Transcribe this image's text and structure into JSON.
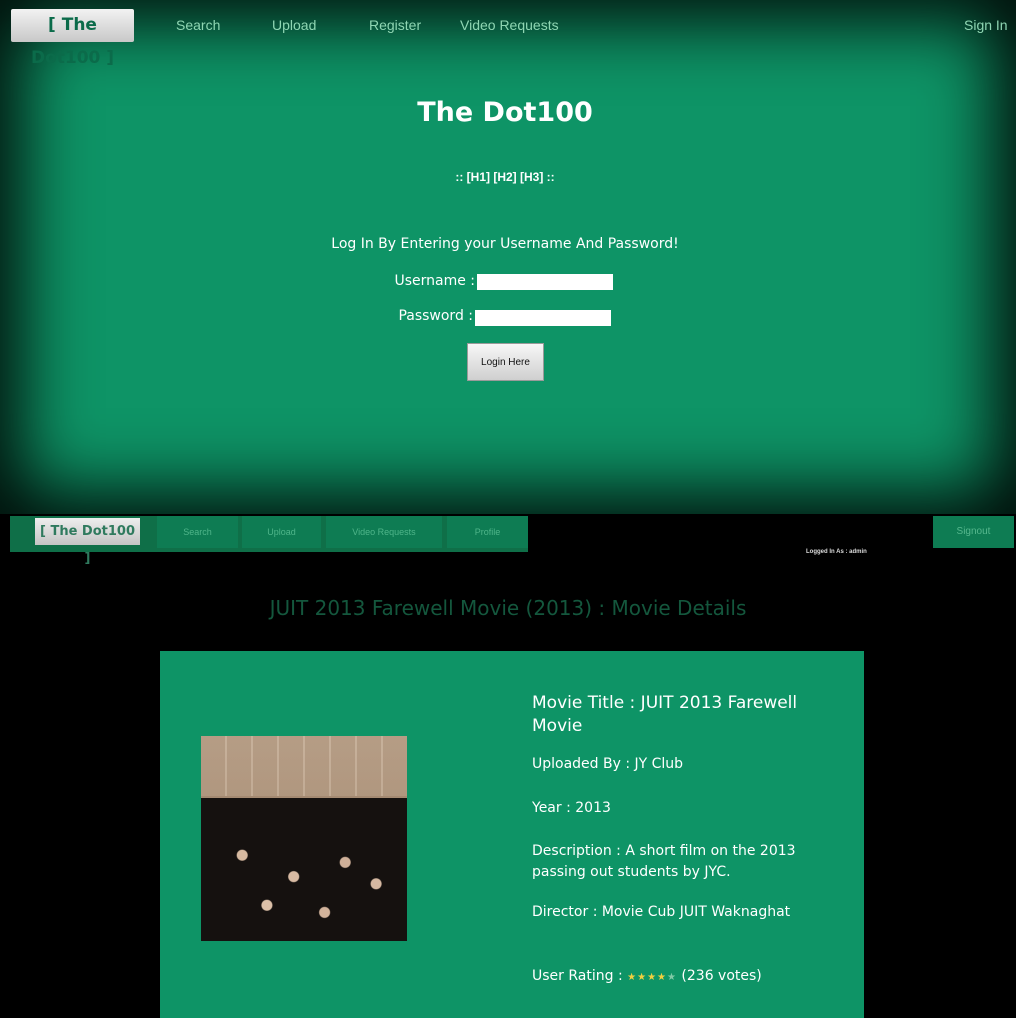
{
  "login_page": {
    "nav": {
      "logo": "[ The Dot100 ]",
      "items": [
        "Search",
        "Upload",
        "Register",
        "Video Requests"
      ],
      "sign_in": "Sign In"
    },
    "title": "The Dot100",
    "heading_links": ":: [H1] [H2] [H3] ::",
    "prompt": "Log In By Entering your Username And Password!",
    "username_label": "Username :",
    "username_value": "",
    "password_label": "Password :",
    "password_value": "",
    "login_button": "Login Here"
  },
  "details_page": {
    "nav": {
      "logo": "[ The Dot100 ]",
      "items": [
        "Search",
        "Upload",
        "Video Requests",
        "Profile"
      ],
      "sign_out": "Signout"
    },
    "logged_in": "Logged In As : admin",
    "heading": "JUIT 2013 Farewell Movie (2013) : Movie Details",
    "movie_title": "Movie Title : JUIT 2013 Farewell Movie",
    "uploaded_by": "Uploaded By : JY Club",
    "year": "Year : 2013",
    "description": "Description : A short film on the 2013 passing out students by JYC.",
    "director": "Director : Movie Cub JUIT Waknaghat",
    "rating_label": "User Rating :",
    "rating_value": 4,
    "rating_max": 5,
    "votes": "(236 votes)"
  }
}
